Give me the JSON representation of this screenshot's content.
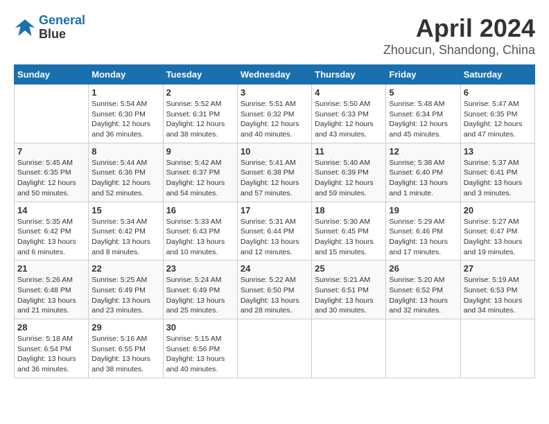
{
  "header": {
    "logo_line1": "General",
    "logo_line2": "Blue",
    "month": "April 2024",
    "location": "Zhoucun, Shandong, China"
  },
  "weekdays": [
    "Sunday",
    "Monday",
    "Tuesday",
    "Wednesday",
    "Thursday",
    "Friday",
    "Saturday"
  ],
  "weeks": [
    [
      {
        "day": "",
        "sunrise": "",
        "sunset": "",
        "daylight": ""
      },
      {
        "day": "1",
        "sunrise": "Sunrise: 5:54 AM",
        "sunset": "Sunset: 6:30 PM",
        "daylight": "Daylight: 12 hours and 36 minutes."
      },
      {
        "day": "2",
        "sunrise": "Sunrise: 5:52 AM",
        "sunset": "Sunset: 6:31 PM",
        "daylight": "Daylight: 12 hours and 38 minutes."
      },
      {
        "day": "3",
        "sunrise": "Sunrise: 5:51 AM",
        "sunset": "Sunset: 6:32 PM",
        "daylight": "Daylight: 12 hours and 40 minutes."
      },
      {
        "day": "4",
        "sunrise": "Sunrise: 5:50 AM",
        "sunset": "Sunset: 6:33 PM",
        "daylight": "Daylight: 12 hours and 43 minutes."
      },
      {
        "day": "5",
        "sunrise": "Sunrise: 5:48 AM",
        "sunset": "Sunset: 6:34 PM",
        "daylight": "Daylight: 12 hours and 45 minutes."
      },
      {
        "day": "6",
        "sunrise": "Sunrise: 5:47 AM",
        "sunset": "Sunset: 6:35 PM",
        "daylight": "Daylight: 12 hours and 47 minutes."
      }
    ],
    [
      {
        "day": "7",
        "sunrise": "Sunrise: 5:45 AM",
        "sunset": "Sunset: 6:35 PM",
        "daylight": "Daylight: 12 hours and 50 minutes."
      },
      {
        "day": "8",
        "sunrise": "Sunrise: 5:44 AM",
        "sunset": "Sunset: 6:36 PM",
        "daylight": "Daylight: 12 hours and 52 minutes."
      },
      {
        "day": "9",
        "sunrise": "Sunrise: 5:42 AM",
        "sunset": "Sunset: 6:37 PM",
        "daylight": "Daylight: 12 hours and 54 minutes."
      },
      {
        "day": "10",
        "sunrise": "Sunrise: 5:41 AM",
        "sunset": "Sunset: 6:38 PM",
        "daylight": "Daylight: 12 hours and 57 minutes."
      },
      {
        "day": "11",
        "sunrise": "Sunrise: 5:40 AM",
        "sunset": "Sunset: 6:39 PM",
        "daylight": "Daylight: 12 hours and 59 minutes."
      },
      {
        "day": "12",
        "sunrise": "Sunrise: 5:38 AM",
        "sunset": "Sunset: 6:40 PM",
        "daylight": "Daylight: 13 hours and 1 minute."
      },
      {
        "day": "13",
        "sunrise": "Sunrise: 5:37 AM",
        "sunset": "Sunset: 6:41 PM",
        "daylight": "Daylight: 13 hours and 3 minutes."
      }
    ],
    [
      {
        "day": "14",
        "sunrise": "Sunrise: 5:35 AM",
        "sunset": "Sunset: 6:42 PM",
        "daylight": "Daylight: 13 hours and 6 minutes."
      },
      {
        "day": "15",
        "sunrise": "Sunrise: 5:34 AM",
        "sunset": "Sunset: 6:42 PM",
        "daylight": "Daylight: 13 hours and 8 minutes."
      },
      {
        "day": "16",
        "sunrise": "Sunrise: 5:33 AM",
        "sunset": "Sunset: 6:43 PM",
        "daylight": "Daylight: 13 hours and 10 minutes."
      },
      {
        "day": "17",
        "sunrise": "Sunrise: 5:31 AM",
        "sunset": "Sunset: 6:44 PM",
        "daylight": "Daylight: 13 hours and 12 minutes."
      },
      {
        "day": "18",
        "sunrise": "Sunrise: 5:30 AM",
        "sunset": "Sunset: 6:45 PM",
        "daylight": "Daylight: 13 hours and 15 minutes."
      },
      {
        "day": "19",
        "sunrise": "Sunrise: 5:29 AM",
        "sunset": "Sunset: 6:46 PM",
        "daylight": "Daylight: 13 hours and 17 minutes."
      },
      {
        "day": "20",
        "sunrise": "Sunrise: 5:27 AM",
        "sunset": "Sunset: 6:47 PM",
        "daylight": "Daylight: 13 hours and 19 minutes."
      }
    ],
    [
      {
        "day": "21",
        "sunrise": "Sunrise: 5:26 AM",
        "sunset": "Sunset: 6:48 PM",
        "daylight": "Daylight: 13 hours and 21 minutes."
      },
      {
        "day": "22",
        "sunrise": "Sunrise: 5:25 AM",
        "sunset": "Sunset: 6:49 PM",
        "daylight": "Daylight: 13 hours and 23 minutes."
      },
      {
        "day": "23",
        "sunrise": "Sunrise: 5:24 AM",
        "sunset": "Sunset: 6:49 PM",
        "daylight": "Daylight: 13 hours and 25 minutes."
      },
      {
        "day": "24",
        "sunrise": "Sunrise: 5:22 AM",
        "sunset": "Sunset: 6:50 PM",
        "daylight": "Daylight: 13 hours and 28 minutes."
      },
      {
        "day": "25",
        "sunrise": "Sunrise: 5:21 AM",
        "sunset": "Sunset: 6:51 PM",
        "daylight": "Daylight: 13 hours and 30 minutes."
      },
      {
        "day": "26",
        "sunrise": "Sunrise: 5:20 AM",
        "sunset": "Sunset: 6:52 PM",
        "daylight": "Daylight: 13 hours and 32 minutes."
      },
      {
        "day": "27",
        "sunrise": "Sunrise: 5:19 AM",
        "sunset": "Sunset: 6:53 PM",
        "daylight": "Daylight: 13 hours and 34 minutes."
      }
    ],
    [
      {
        "day": "28",
        "sunrise": "Sunrise: 5:18 AM",
        "sunset": "Sunset: 6:54 PM",
        "daylight": "Daylight: 13 hours and 36 minutes."
      },
      {
        "day": "29",
        "sunrise": "Sunrise: 5:16 AM",
        "sunset": "Sunset: 6:55 PM",
        "daylight": "Daylight: 13 hours and 38 minutes."
      },
      {
        "day": "30",
        "sunrise": "Sunrise: 5:15 AM",
        "sunset": "Sunset: 6:56 PM",
        "daylight": "Daylight: 13 hours and 40 minutes."
      },
      {
        "day": "",
        "sunrise": "",
        "sunset": "",
        "daylight": ""
      },
      {
        "day": "",
        "sunrise": "",
        "sunset": "",
        "daylight": ""
      },
      {
        "day": "",
        "sunrise": "",
        "sunset": "",
        "daylight": ""
      },
      {
        "day": "",
        "sunrise": "",
        "sunset": "",
        "daylight": ""
      }
    ]
  ]
}
